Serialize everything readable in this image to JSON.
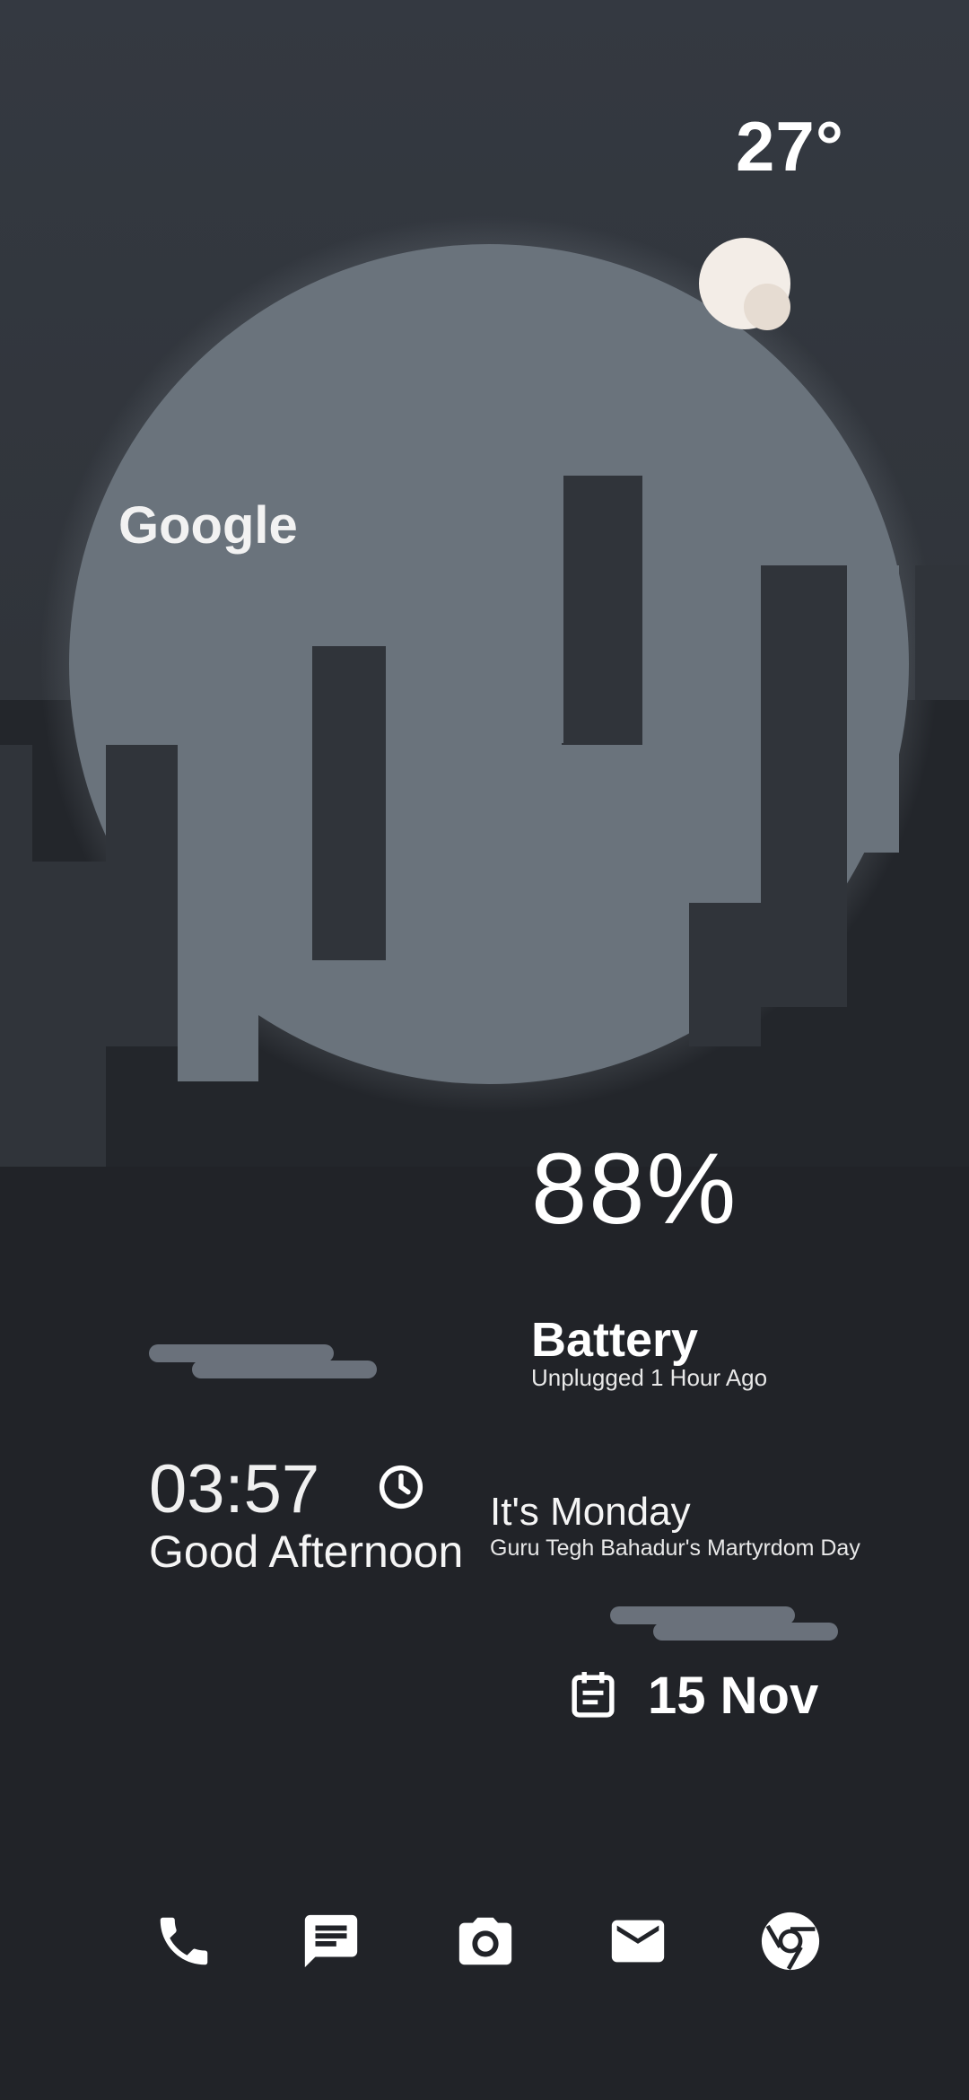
{
  "weather": {
    "temperature": "27°",
    "icon": "moon-icon"
  },
  "search": {
    "label": "Google"
  },
  "battery": {
    "percent": "88%",
    "title": "Battery",
    "status": "Unplugged 1 Hour Ago"
  },
  "clock": {
    "time": "03:57",
    "greeting": "Good Afternoon",
    "icon": "clock-icon"
  },
  "calendar": {
    "day": "It's Monday",
    "holiday": "Guru Tegh Bahadur's Martyrdom Day",
    "date": "15 Nov",
    "icon": "calendar-icon"
  },
  "dock": [
    {
      "name": "phone",
      "icon": "phone-icon"
    },
    {
      "name": "messages",
      "icon": "message-icon"
    },
    {
      "name": "camera",
      "icon": "camera-icon"
    },
    {
      "name": "email",
      "icon": "mail-icon"
    },
    {
      "name": "chrome",
      "icon": "chrome-icon"
    }
  ],
  "colors": {
    "background": "#212328",
    "sky": "#343941",
    "buildings": "#6a737c",
    "moon": "#f2ece6"
  }
}
